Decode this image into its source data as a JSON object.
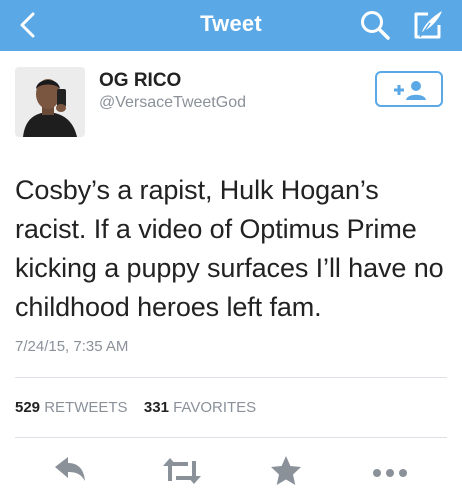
{
  "navbar": {
    "title": "Tweet",
    "background": "#5aa9e6",
    "icons": [
      "back-chevron-icon",
      "search-icon",
      "compose-icon"
    ]
  },
  "tweet": {
    "author_name": "OG RICO",
    "author_handle": "@VersaceTweetGod",
    "text": "Cosby’s a rapist, Hulk Hogan’s racist. If a video of Optimus Prime kicking a puppy surfaces I’ll have no childhood heroes left fam.",
    "timestamp": "7/24/15, 7:35 AM",
    "stats": {
      "retweets_count": "529",
      "retweets_label": "RETWEETS",
      "favorites_count": "331",
      "favorites_label": "FAVORITES"
    }
  },
  "follow_button": {
    "icon": "add-user-icon",
    "accent": "#5aa9e6"
  },
  "actions": [
    "reply-icon",
    "retweet-icon",
    "favorite-star-icon",
    "more-icon"
  ],
  "colors": {
    "icon_gray": "#8a9199",
    "text": "#222222"
  }
}
